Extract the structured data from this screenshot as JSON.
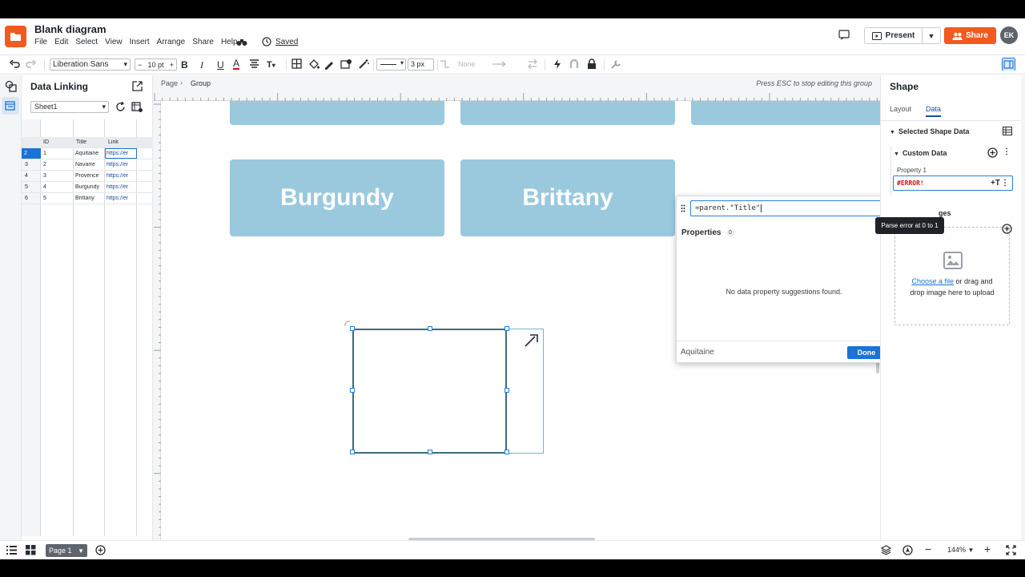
{
  "header": {
    "doc_title": "Blank diagram",
    "menus": [
      "File",
      "Edit",
      "Select",
      "View",
      "Insert",
      "Arrange",
      "Share",
      "Help"
    ],
    "saved_label": "Saved",
    "present_label": "Present",
    "share_label": "Share",
    "avatar_initials": "EK",
    "brand_color": "#f25a1f"
  },
  "toolbar": {
    "font_family": "Liberation Sans",
    "font_size": "10 pt",
    "line_width": "3 px",
    "endpoint_style": "None"
  },
  "left_panel": {
    "title": "Data Linking",
    "sheet": "Sheet1",
    "columns": [
      "ID",
      "Title",
      "Link"
    ],
    "rows": [
      {
        "num": "2",
        "id": "1",
        "title": "Aquitaine",
        "link": "https://er"
      },
      {
        "num": "3",
        "id": "2",
        "title": "Navarre",
        "link": "https://er"
      },
      {
        "num": "4",
        "id": "3",
        "title": "Provence",
        "link": "https://er"
      },
      {
        "num": "5",
        "id": "4",
        "title": "Burgundy",
        "link": "https://er"
      },
      {
        "num": "6",
        "id": "5",
        "title": "Brittany",
        "link": "https://er"
      }
    ]
  },
  "breadcrumb": {
    "page": "Page",
    "group": "Group",
    "hint": "Press ESC to stop editing this group"
  },
  "canvas": {
    "tile_burgundy": "Burgundy",
    "tile_brittany": "Brittany",
    "tile_color": "#9ac9de"
  },
  "formula_popover": {
    "formula": "=parent.\"Title\"",
    "properties_label": "Properties",
    "properties_count": "0",
    "empty_text": "No data property suggestions found.",
    "context_value": "Aquitaine",
    "done_label": "Done",
    "error_tooltip": "Parse error at 0 to 1"
  },
  "right_panel": {
    "title": "Shape",
    "tabs": [
      "Layout",
      "Data"
    ],
    "active_tab": "Data",
    "section": "Selected Shape Data",
    "custom_data": "Custom Data",
    "property_name": "Property 1",
    "property_value": "#ERROR!",
    "images_label": "ges",
    "upload_link": "Choose a file",
    "upload_text1": " or drag and",
    "upload_text2": "drop image here to upload"
  },
  "bottom": {
    "page_tab": "Page 1",
    "zoom": "144%"
  }
}
